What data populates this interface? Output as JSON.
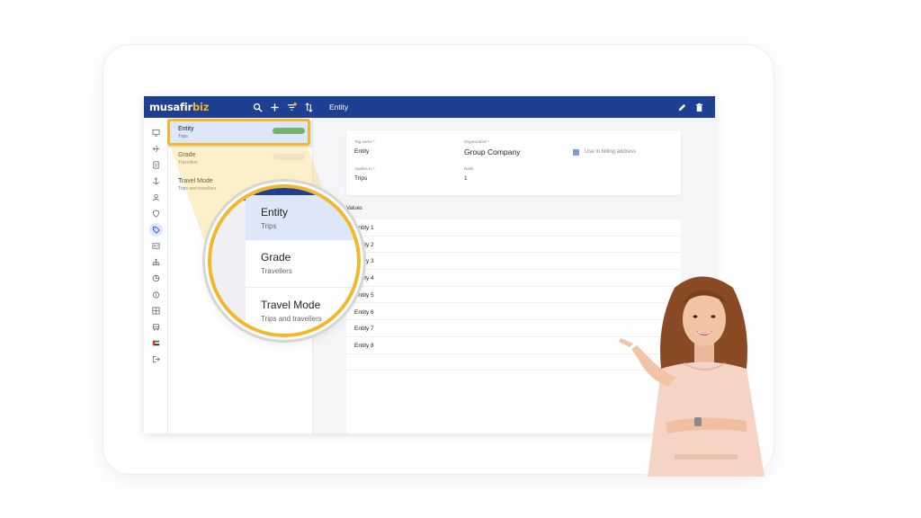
{
  "brand": {
    "logo_part1": "musafir",
    "logo_part2": "biz",
    "logo_accent_color": "#f5b421",
    "header_color": "#1f3f93"
  },
  "topbar": {
    "title": "Entity",
    "icons": [
      "search-icon",
      "add-icon",
      "filter-icon",
      "sort-icon",
      "edit-icon",
      "delete-icon"
    ]
  },
  "rail": {
    "icons": [
      "monitor-icon",
      "flight-icon",
      "document-icon",
      "anchor-icon",
      "user-icon",
      "shield-icon",
      "tag-icon",
      "id-card-icon",
      "hierarchy-icon",
      "pie-chart-icon",
      "money-icon",
      "grid-icon",
      "bus-icon",
      "flag-icon",
      "logout-icon"
    ],
    "active_index": 6
  },
  "list": {
    "items": [
      {
        "title": "Entity",
        "subtitle": "Trips",
        "selected": true
      },
      {
        "title": "Grade",
        "subtitle": "Travellers",
        "selected": false
      },
      {
        "title": "Travel Mode",
        "subtitle": "Trips and travellers",
        "selected": false
      }
    ]
  },
  "form": {
    "tag_name_label": "Tag name *",
    "tag_name_value": "Entity",
    "organization_label": "Organization *",
    "organization_value": "Group Company",
    "billing_label": "Use in billing address",
    "billing_checked": true,
    "applies_label": "Applies to *",
    "applies_value": "Trips",
    "rank_label": "Rank",
    "rank_value": "1"
  },
  "values": {
    "title": "Values",
    "rows": [
      "Entity 1",
      "Entity 2",
      "Entity 3",
      "Entity 4",
      "Entity 5",
      "Entity 6",
      "Entity 7",
      "Entity 8"
    ]
  },
  "zoom": {
    "items": [
      {
        "title": "Entity",
        "subtitle": "Trips"
      },
      {
        "title": "Grade",
        "subtitle": "Travellers"
      },
      {
        "title": "Travel Mode",
        "subtitle": "Trips and travellers"
      }
    ]
  }
}
